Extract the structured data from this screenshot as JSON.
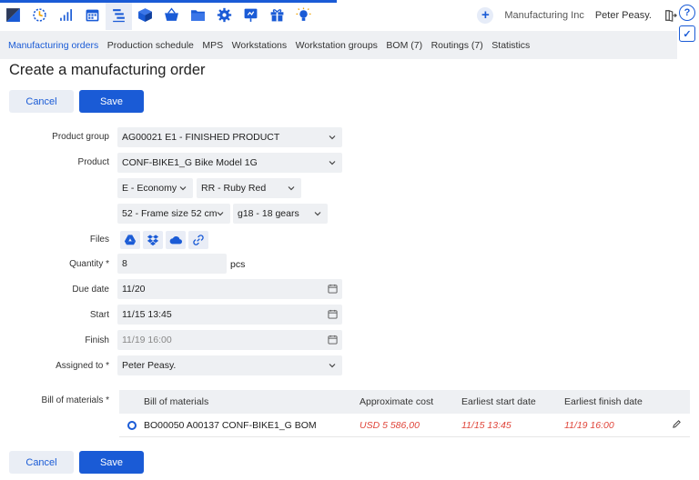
{
  "header": {
    "company": "Manufacturing Inc",
    "user": "Peter Peasy.",
    "apps": [
      {
        "icon": "dashboard-icon"
      },
      {
        "icon": "crm-icon"
      },
      {
        "icon": "bar-chart-icon"
      },
      {
        "icon": "calendar-icon"
      },
      {
        "icon": "production-icon",
        "active": true
      },
      {
        "icon": "inventory-box-icon"
      },
      {
        "icon": "basket-icon"
      },
      {
        "icon": "folder-icon"
      },
      {
        "icon": "gear-icon"
      },
      {
        "icon": "dashboard-screen-icon"
      },
      {
        "icon": "gift-icon"
      },
      {
        "icon": "lightbulb-icon"
      }
    ]
  },
  "side": {
    "help": "?",
    "check": "✓"
  },
  "subnav": {
    "items": [
      {
        "label": "Manufacturing orders",
        "active": true
      },
      {
        "label": "Production schedule"
      },
      {
        "label": "MPS"
      },
      {
        "label": "Workstations"
      },
      {
        "label": "Workstation groups"
      },
      {
        "label": "BOM (7)"
      },
      {
        "label": "Routings (7)"
      },
      {
        "label": "Statistics"
      }
    ]
  },
  "page": {
    "title": "Create a manufacturing order"
  },
  "actions": {
    "cancel": "Cancel",
    "save": "Save"
  },
  "form": {
    "product_group_label": "Product group",
    "product_group_value": "AG00021 E1 - FINISHED PRODUCT",
    "product_label": "Product",
    "product_value": "CONF-BIKE1_G Bike Model 1G",
    "option_economy": "E - Economy",
    "option_color": "RR - Ruby Red",
    "option_frame": "52 - Frame size 52 cm",
    "option_gears": "g18 - 18 gears",
    "files_label": "Files",
    "quantity_label": "Quantity *",
    "quantity_value": "8",
    "quantity_unit": "pcs",
    "due_date_label": "Due date",
    "due_date_value": "11/20",
    "start_label": "Start",
    "start_value": "11/15 13:45",
    "finish_label": "Finish",
    "finish_value": "11/19 16:00",
    "assigned_label": "Assigned to *",
    "assigned_value": "Peter Peasy.",
    "bom_label": "Bill of materials *"
  },
  "bom_table": {
    "headers": [
      "Bill of materials",
      "Approximate cost",
      "Earliest start date",
      "Earliest finish date"
    ],
    "rows": [
      {
        "name": "BO00050 A00137 CONF-BIKE1_G BOM",
        "cost": "USD 5 586,00",
        "start": "11/15 13:45",
        "finish": "11/19 16:00"
      }
    ]
  },
  "colors": {
    "accent": "#1a5bd6",
    "warning": "#e0453a",
    "field_bg": "#eef0f3"
  }
}
